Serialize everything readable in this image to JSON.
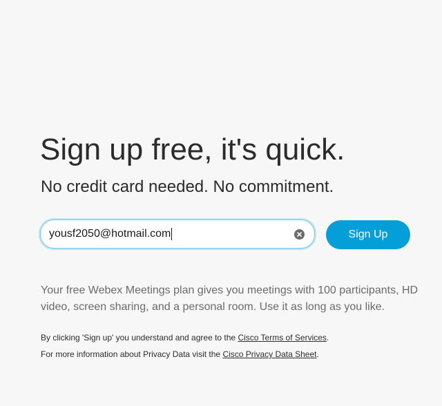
{
  "headline": "Sign up free, it's quick.",
  "subheadline": "No credit card needed. No commitment.",
  "signup_form": {
    "email_value": "yousf2050@hotmail.com",
    "button_label": "Sign Up",
    "clear_icon": "clear-circle-icon"
  },
  "description": "Your free Webex Meetings plan gives you meetings with 100 participants, HD video, screen sharing, and a personal room. Use it as long as you like.",
  "legal": {
    "terms_prefix": "By clicking 'Sign up' you understand and agree to the ",
    "terms_link": "Cisco Terms of Services",
    "terms_suffix": ".",
    "privacy_prefix": "For more information about Privacy Data visit the ",
    "privacy_link": "Cisco Privacy Data Sheet",
    "privacy_suffix": "."
  },
  "colors": {
    "background": "#f7f7f7",
    "accent": "#049fd9",
    "focus_ring": "#7cc8e6",
    "text": "#2b2b2b",
    "muted_text": "#6b6b6b"
  }
}
